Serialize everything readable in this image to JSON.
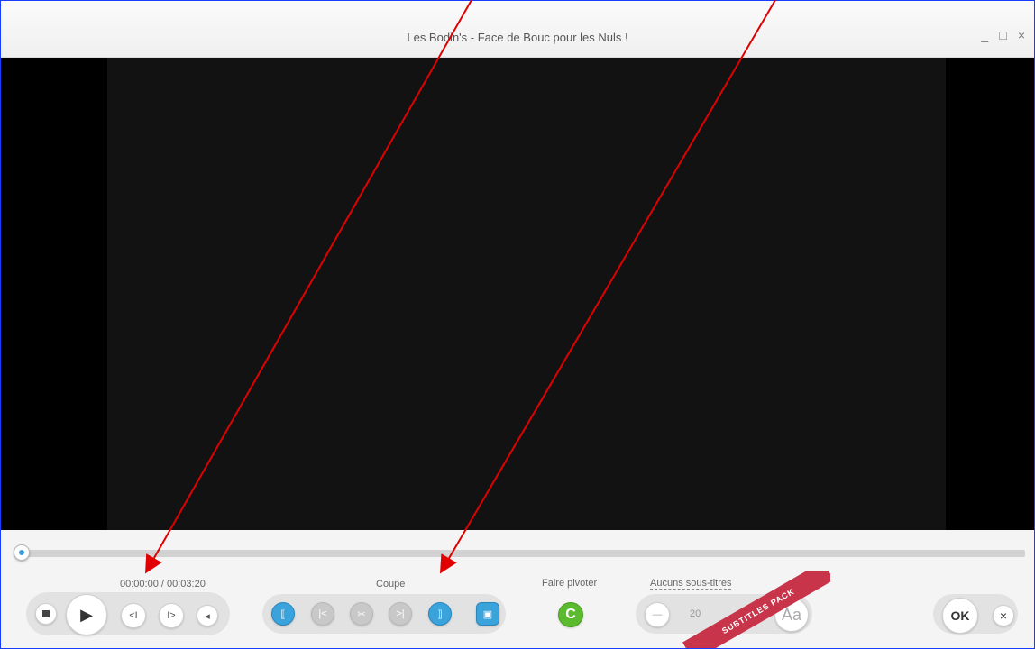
{
  "window": {
    "title": "Les Bodin's - Face de Bouc pour les Nuls !",
    "minimize": "_",
    "maximize": "□",
    "close": "×"
  },
  "playback": {
    "time": "00:00:00 / 00:03:20",
    "progress": 0.0,
    "stop_icon": "stop-icon",
    "play_icon": "play-icon",
    "prev_frame_label": "<I",
    "next_frame_label": "I>",
    "volume_icon": "volume-icon"
  },
  "cut": {
    "label": "Coupe",
    "buttons": [
      "mark-in-icon",
      "go-to-start-icon",
      "scissors-icon",
      "go-to-end-icon",
      "mark-out-icon",
      "preview-icon"
    ]
  },
  "rotate": {
    "label": "Faire pivoter",
    "icon": "rotate-icon",
    "glyph": "C"
  },
  "subtitles": {
    "label": "Aucuns sous-titres",
    "size_value": "20",
    "minus_glyph": "—",
    "font_label": "Aa",
    "ribbon_text": "SUBTITLES PACK"
  },
  "actions": {
    "ok_label": "OK",
    "cancel_label": "×"
  },
  "colors": {
    "accent": "#3aa3dc",
    "rotate": "#5cba2e",
    "ribbon": "#c8344a",
    "annotation_arrow": "#e00000"
  }
}
